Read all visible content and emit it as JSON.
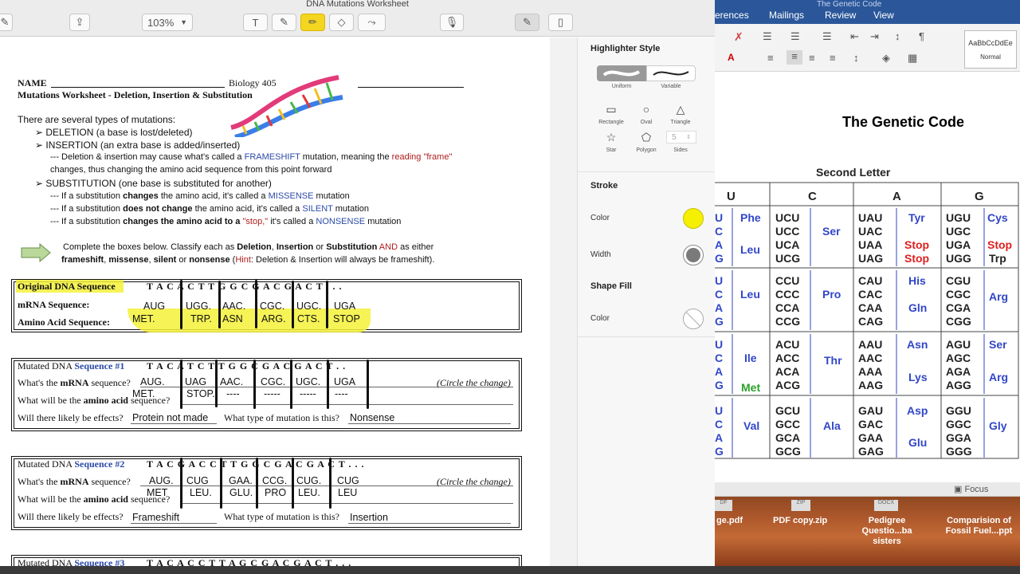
{
  "window_title": "DNA Mutations Worksheet",
  "toolbar": {
    "zoom": "103%"
  },
  "worksheet": {
    "name_label": "NAME",
    "course": "Biology 405",
    "title": "Mutations Worksheet - Deletion, Insertion & Substitution",
    "intro": "There are several types of mutations:",
    "deletion_term": "DELETION",
    "deletion_desc": "(a base is lost/deleted)",
    "insertion_term": "INSERTION",
    "insertion_desc": "(an extra base is added/inserted)",
    "fs_line1a": "--- Deletion & insertion may cause what's called a",
    "fs_word": "FRAMESHIFT",
    "fs_line1b": "mutation, meaning the",
    "fs_reading": "reading",
    "fs_frame": "\"frame\"",
    "fs_line2": "changes, thus changing the amino acid sequence from this point forward",
    "subst_term": "SUBSTITUTION",
    "subst_desc": "(one base is substituted for another)",
    "ms_a": "--- If a substitution",
    "ms_b": "changes",
    "ms_c": "the amino acid, it's called a",
    "ms_word": "MISSENSE",
    "ms_d": "mutation",
    "si_a": "--- If a substitution",
    "si_b": "does not change",
    "si_c": "the amino acid, it's called a",
    "si_word": "SILENT",
    "si_d": "mutation",
    "ns_a": "--- If a substitution",
    "ns_b": "changes the amino acid to a",
    "ns_stop": "\"stop,\"",
    "ns_c": "it's called a",
    "ns_word": "NONSENSE",
    "ns_d": "mutation",
    "instr1a": "Complete the boxes below.  Classify each as",
    "instr_del": "Deletion",
    "instr_ins": "Insertion",
    "instr_or": "or",
    "instr_sub": "Substitution",
    "instr_and": "AND",
    "instr_either": "as either",
    "instr2a": "frameshift",
    "instr2b": "missense",
    "instr2c": "silent",
    "instr2d": "nonsense",
    "instr_hint": "Hint",
    "instr_hint_text": ": Deletion & Insertion will always be frameshift).",
    "orig_label": "Original DNA Sequence",
    "orig_seq": "T A C A C T T G G C G A C G A C T . . .",
    "mrna_label": "mRNA Sequence:",
    "aa_label": "Amino Acid Sequence:",
    "orig_mrna": [
      "AUG",
      "UGG.",
      "AAC.",
      "CGC.",
      "UGC.",
      "UGA"
    ],
    "orig_aa": [
      "MET.",
      "TRP.",
      "ASN",
      "ARG.",
      "CTS.",
      "STOP"
    ],
    "m1_label": "Mutated DNA",
    "m1_seqword": "Sequence #1",
    "m1_seq": "T A C A T C T T G G C G A C G A C T . .",
    "q_mrna": "What's the",
    "q_mrna_b": "mRNA",
    "q_mrna_c": "sequence?",
    "q_aa": "What will be the",
    "q_aa_b": "amino acid",
    "q_aa_c": "sequence?",
    "circle": "(Circle the change)",
    "q_effects": "Will there likely be effects?",
    "q_type": "What type of mutation is this?",
    "m1_mrna": [
      "AUG.",
      "UAG",
      "AAC.",
      "CGC.",
      "UGC.",
      "UGA"
    ],
    "m1_aa": [
      "MET.",
      "STOP.",
      "----",
      "-----",
      "-----",
      "----"
    ],
    "m1_effects": "Protein not made",
    "m1_type": "Nonsense",
    "m2_label": "Mutated DNA",
    "m2_seqword": "Sequence #2",
    "m2_seq": "T A C G A C C T T G G C G A C G A C T . . .",
    "m2_mrna": [
      "AUG.",
      "CUG",
      "GAA.",
      "CCG.",
      "CUG.",
      "CUG"
    ],
    "m2_aa": [
      "MET",
      "LEU.",
      "GLU.",
      "PRO",
      "LEU.",
      "LEU"
    ],
    "m2_effects": "Frameshift",
    "m2_type": "Insertion",
    "m3_label": "Mutated DNA",
    "m3_seqword": "Sequence #3",
    "m3_seq": "T A C A C C T T A G C G A C G A C T . . ."
  },
  "inspector": {
    "highlighter_style": "Highlighter Style",
    "uniform": "Uniform",
    "variable": "Variable",
    "shapes": [
      "Rectangle",
      "Oval",
      "Triangle",
      "Star",
      "Polygon",
      "Sides"
    ],
    "sides_value": "5",
    "stroke": "Stroke",
    "color": "Color",
    "width": "Width",
    "shape_fill": "Shape Fill",
    "fill_color": "Color",
    "stroke_color": "#f5ef00"
  },
  "word": {
    "window_title": "The Genetic Code",
    "tabs": [
      "erences",
      "Mailings",
      "Review",
      "View"
    ],
    "style_sample": "AaBbCcDdEe",
    "style_name": "Normal",
    "title": "The Genetic Code",
    "second_letter": "Second Letter",
    "headers": [
      "U",
      "C",
      "A",
      "G"
    ],
    "first_col": [
      [
        "U",
        "C",
        "A",
        "G"
      ],
      [
        "U",
        "C",
        "A",
        "G"
      ],
      [
        "U",
        "C",
        "A",
        "G"
      ],
      [
        "U",
        "C",
        "A",
        "G"
      ]
    ],
    "rows": [
      {
        "u_aa": [
          "Phe",
          "Leu"
        ],
        "c": [
          "UCU",
          "UCC",
          "UCA",
          "UCG"
        ],
        "c_aa": "Ser",
        "a": [
          "UAU",
          "UAC",
          "UAA",
          "UAG"
        ],
        "a_aa": [
          "Tyr",
          "Stop",
          "Stop"
        ],
        "g": [
          "UGU",
          "UGC",
          "UGA",
          "UGG"
        ],
        "g_aa": [
          "Cys",
          "Stop",
          "Trp"
        ]
      },
      {
        "u_aa": [
          "Leu"
        ],
        "c": [
          "CCU",
          "CCC",
          "CCA",
          "CCG"
        ],
        "c_aa": "Pro",
        "a": [
          "CAU",
          "CAC",
          "CAA",
          "CAG"
        ],
        "a_aa": [
          "His",
          "Gln"
        ],
        "g": [
          "CGU",
          "CGC",
          "CGA",
          "CGG"
        ],
        "g_aa": [
          "Arg"
        ]
      },
      {
        "u_aa": [
          "Ile",
          "Met"
        ],
        "c": [
          "ACU",
          "ACC",
          "ACA",
          "ACG"
        ],
        "c_aa": "Thr",
        "a": [
          "AAU",
          "AAC",
          "AAA",
          "AAG"
        ],
        "a_aa": [
          "Asn",
          "Lys"
        ],
        "g": [
          "AGU",
          "AGC",
          "AGA",
          "AGG"
        ],
        "g_aa": [
          "Ser",
          "Arg"
        ]
      },
      {
        "u_aa": [
          "Val"
        ],
        "c": [
          "GCU",
          "GCC",
          "GCA",
          "GCG"
        ],
        "c_aa": "Ala",
        "a": [
          "GAU",
          "GAC",
          "GAA",
          "GAG"
        ],
        "a_aa": [
          "Asp",
          "Glu"
        ],
        "g": [
          "GGU",
          "GGC",
          "GGA",
          "GGG"
        ],
        "g_aa": [
          "Gly"
        ]
      }
    ],
    "focus": "Focus"
  },
  "desktop": {
    "files": [
      {
        "badge": "DF",
        "name": "ge.pdf"
      },
      {
        "badge": "ZIP",
        "name": "PDF copy.zip"
      },
      {
        "badge": "DOCX",
        "name": "Pedigree Questio...ba sisters"
      },
      {
        "badge": "",
        "name": "Comparision of Fossil Fuel...ppt"
      }
    ]
  }
}
